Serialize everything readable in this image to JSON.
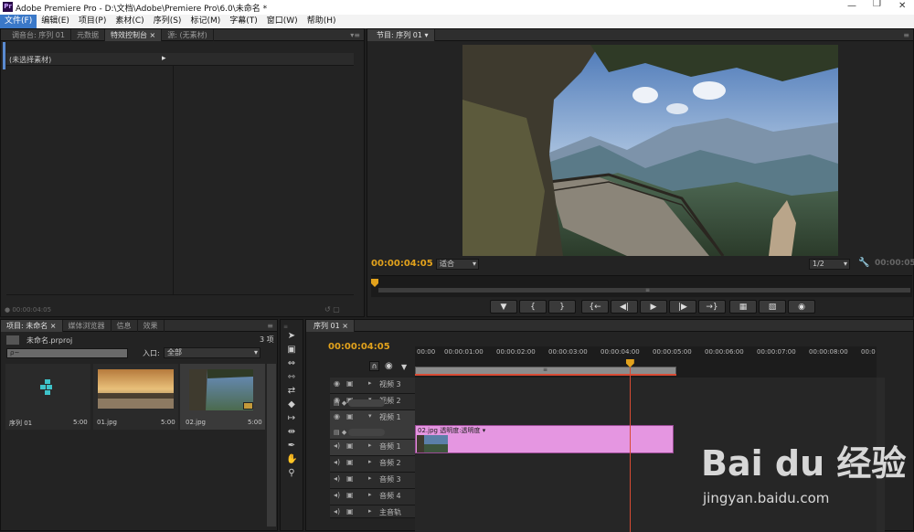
{
  "app": {
    "title": "Adobe Premiere Pro - D:\\文档\\Adobe\\Premiere Pro\\6.0\\未命名 *"
  },
  "menu": [
    "文件(F)",
    "编辑(E)",
    "项目(P)",
    "素材(C)",
    "序列(S)",
    "标记(M)",
    "字幕(T)",
    "窗口(W)",
    "帮助(H)"
  ],
  "source_panel": {
    "tabs": [
      "调音台: 序列 01",
      "元数据",
      "特效控制台",
      "源: (无素材)"
    ],
    "active_tab": 2,
    "no_clip_label": "(未选择素材)",
    "timecode": "00:00:04:05"
  },
  "program_monitor": {
    "tab": "节目: 序列 01",
    "timecode": "00:00:04:05",
    "fit": "适合",
    "resolution": "1/2",
    "end_timecode": "00:00:05"
  },
  "project_panel": {
    "tabs": [
      "项目: 未命名",
      "媒体浏览器",
      "信息",
      "效果"
    ],
    "file": "未命名.prproj",
    "count": "3 项",
    "search_placeholder": "ρ~",
    "entry_label": "入口:",
    "entry_value": "全部",
    "items": [
      {
        "name": "序列 01",
        "duration": "5:00"
      },
      {
        "name": "01.jpg",
        "duration": "5:00"
      },
      {
        "name": "02.jpg",
        "duration": "5:00"
      }
    ]
  },
  "timeline": {
    "tab": "序列 01",
    "timecode": "00:00:04:05",
    "ruler": [
      "00:00",
      "00:00:01:00",
      "00:00:02:00",
      "00:00:03:00",
      "00:00:04:00",
      "00:00:05:00",
      "00:00:06:00",
      "00:00:07:00",
      "00:00:08:00",
      "00:0"
    ],
    "playhead_fraction": 0.465,
    "tracks": [
      {
        "name": "视频 3",
        "kind": "video"
      },
      {
        "name": "视频 2",
        "kind": "video"
      },
      {
        "name": "视频 1",
        "kind": "video"
      },
      {
        "name": "音频 1",
        "kind": "audio"
      },
      {
        "name": "音频 2",
        "kind": "audio"
      },
      {
        "name": "音频 3",
        "kind": "audio"
      },
      {
        "name": "音频 4",
        "kind": "audio"
      },
      {
        "name": "主音轨",
        "kind": "master"
      }
    ],
    "clip": {
      "label": "02.jpg",
      "fx": "透明度:透明度"
    }
  },
  "watermark": {
    "brand": "Bai du 经验",
    "url": "jingyan.baidu.com"
  },
  "colors": {
    "timecode": "#e2a21c",
    "clip": "#e596e1",
    "playhead": "#d84b34",
    "accent": "#3a78c8"
  }
}
